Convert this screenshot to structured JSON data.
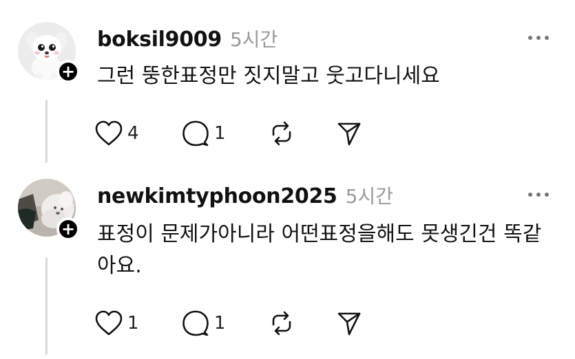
{
  "comments": [
    {
      "username": "boksil9009",
      "time": "5시간",
      "text": "그런 뚱한표정만 짓지말고 웃고다니세요",
      "likes": "4",
      "replies": "1",
      "avatar": "white-puppy-avatar"
    },
    {
      "username": "newkimtyphoon2025",
      "time": "5시간",
      "text": "표정이 문제가아니라 어떤표정을해도 못생긴건 똑같아요.",
      "likes": "1",
      "replies": "1",
      "avatar": "dog-photo-avatar"
    }
  ],
  "icons": {
    "follow": "plus-icon",
    "more": "ellipsis-icon",
    "like": "heart-icon",
    "reply": "comment-icon",
    "repost": "repost-icon",
    "share": "send-icon"
  }
}
